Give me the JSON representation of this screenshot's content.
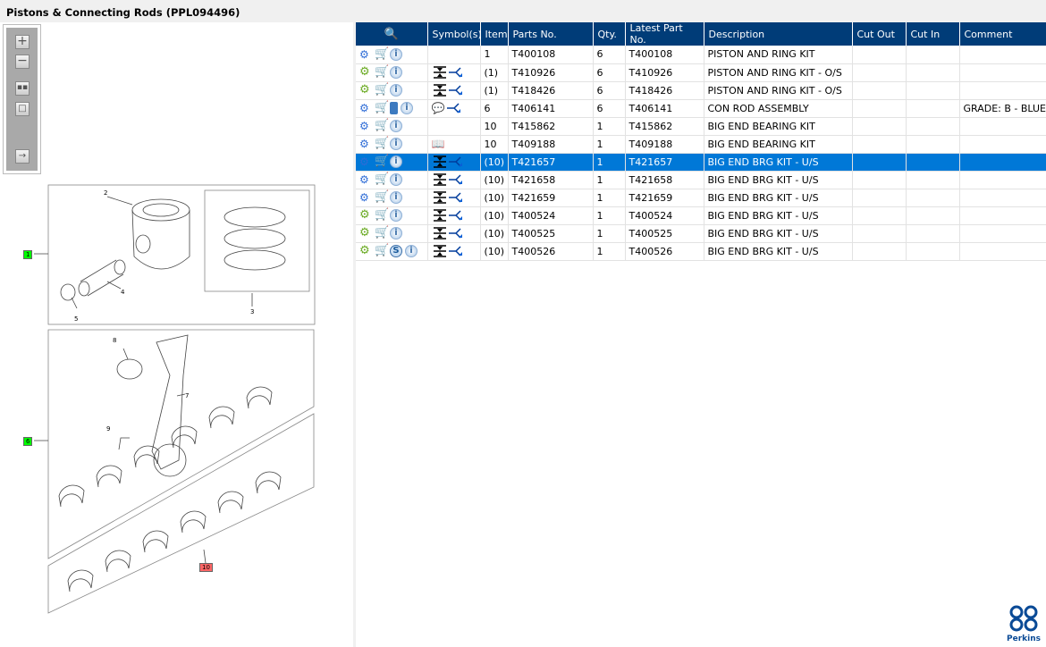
{
  "title": "Pistons & Connecting Rods (PPL094496)",
  "toolbar": {
    "zoom_in": "+",
    "zoom_out": "−"
  },
  "diagram": {
    "callouts": [
      "1",
      "6",
      "10"
    ],
    "numbers": [
      "2",
      "3",
      "4",
      "5",
      "7",
      "8",
      "9"
    ]
  },
  "table": {
    "headers": [
      "",
      "Symbol(s)",
      "Item",
      "Parts No.",
      "Qty.",
      "Latest Part No.",
      "Description",
      "Cut Out",
      "Cut In",
      "Comment"
    ],
    "rows": [
      {
        "icons": [
          "gears",
          "cart",
          "info"
        ],
        "symbols": [],
        "item": "1",
        "part": "T400108",
        "qty": "6",
        "latest": "T400108",
        "desc": "PISTON AND RING KIT",
        "cut_out": "",
        "cut_in": "",
        "comment": ""
      },
      {
        "icons": [
          "gear",
          "cart",
          "info"
        ],
        "symbols": [
          "compress",
          "replace"
        ],
        "item": "(1)",
        "part": "T410926",
        "qty": "6",
        "latest": "T410926",
        "desc": "PISTON AND RING KIT - O/S",
        "cut_out": "",
        "cut_in": "",
        "comment": ""
      },
      {
        "icons": [
          "gear",
          "cart",
          "info"
        ],
        "symbols": [
          "compress",
          "replace"
        ],
        "item": "(1)",
        "part": "T418426",
        "qty": "6",
        "latest": "T418426",
        "desc": "PISTON AND RING KIT - O/S",
        "cut_out": "",
        "cut_in": "",
        "comment": ""
      },
      {
        "icons": [
          "gears",
          "cart",
          "book",
          "info"
        ],
        "symbols": [
          "note",
          "replace"
        ],
        "item": "6",
        "part": "T406141",
        "qty": "6",
        "latest": "T406141",
        "desc": "CON ROD ASSEMBLY",
        "cut_out": "",
        "cut_in": "",
        "comment": "GRADE: B - BLUE"
      },
      {
        "icons": [
          "gears",
          "cart",
          "info"
        ],
        "symbols": [],
        "item": "10",
        "part": "T415862",
        "qty": "1",
        "latest": "T415862",
        "desc": "BIG END BEARING KIT",
        "cut_out": "",
        "cut_in": "",
        "comment": ""
      },
      {
        "icons": [
          "gears",
          "cart",
          "info"
        ],
        "symbols": [
          "manual"
        ],
        "item": "10",
        "part": "T409188",
        "qty": "1",
        "latest": "T409188",
        "desc": "BIG END BEARING KIT",
        "cut_out": "",
        "cut_in": "",
        "comment": ""
      },
      {
        "icons": [
          "gears",
          "cart",
          "info"
        ],
        "symbols": [
          "compress",
          "replace"
        ],
        "item": "(10)",
        "part": "T421657",
        "qty": "1",
        "latest": "T421657",
        "desc": "BIG END BRG KIT - U/S",
        "cut_out": "",
        "cut_in": "",
        "comment": "",
        "selected": true
      },
      {
        "icons": [
          "gears",
          "cart",
          "info"
        ],
        "symbols": [
          "compress",
          "replace"
        ],
        "item": "(10)",
        "part": "T421658",
        "qty": "1",
        "latest": "T421658",
        "desc": "BIG END BRG KIT - U/S",
        "cut_out": "",
        "cut_in": "",
        "comment": ""
      },
      {
        "icons": [
          "gears",
          "cart",
          "info"
        ],
        "symbols": [
          "compress",
          "replace"
        ],
        "item": "(10)",
        "part": "T421659",
        "qty": "1",
        "latest": "T421659",
        "desc": "BIG END BRG KIT - U/S",
        "cut_out": "",
        "cut_in": "",
        "comment": ""
      },
      {
        "icons": [
          "gear",
          "cart",
          "info"
        ],
        "symbols": [
          "compress",
          "replace"
        ],
        "item": "(10)",
        "part": "T400524",
        "qty": "1",
        "latest": "T400524",
        "desc": "BIG END BRG KIT - U/S",
        "cut_out": "",
        "cut_in": "",
        "comment": ""
      },
      {
        "icons": [
          "gear",
          "cart",
          "info"
        ],
        "symbols": [
          "compress",
          "replace"
        ],
        "item": "(10)",
        "part": "T400525",
        "qty": "1",
        "latest": "T400525",
        "desc": "BIG END BRG KIT - U/S",
        "cut_out": "",
        "cut_in": "",
        "comment": ""
      },
      {
        "icons": [
          "gear",
          "cart",
          "s",
          "info"
        ],
        "symbols": [
          "compress",
          "replace"
        ],
        "item": "(10)",
        "part": "T400526",
        "qty": "1",
        "latest": "T400526",
        "desc": "BIG END BRG KIT - U/S",
        "cut_out": "",
        "cut_in": "",
        "comment": ""
      }
    ]
  },
  "logo": "Perkins",
  "colors": {
    "header": "#003c78",
    "selected": "#0078d7",
    "callout_green": "#00ff00",
    "callout_red": "#ff6666"
  }
}
